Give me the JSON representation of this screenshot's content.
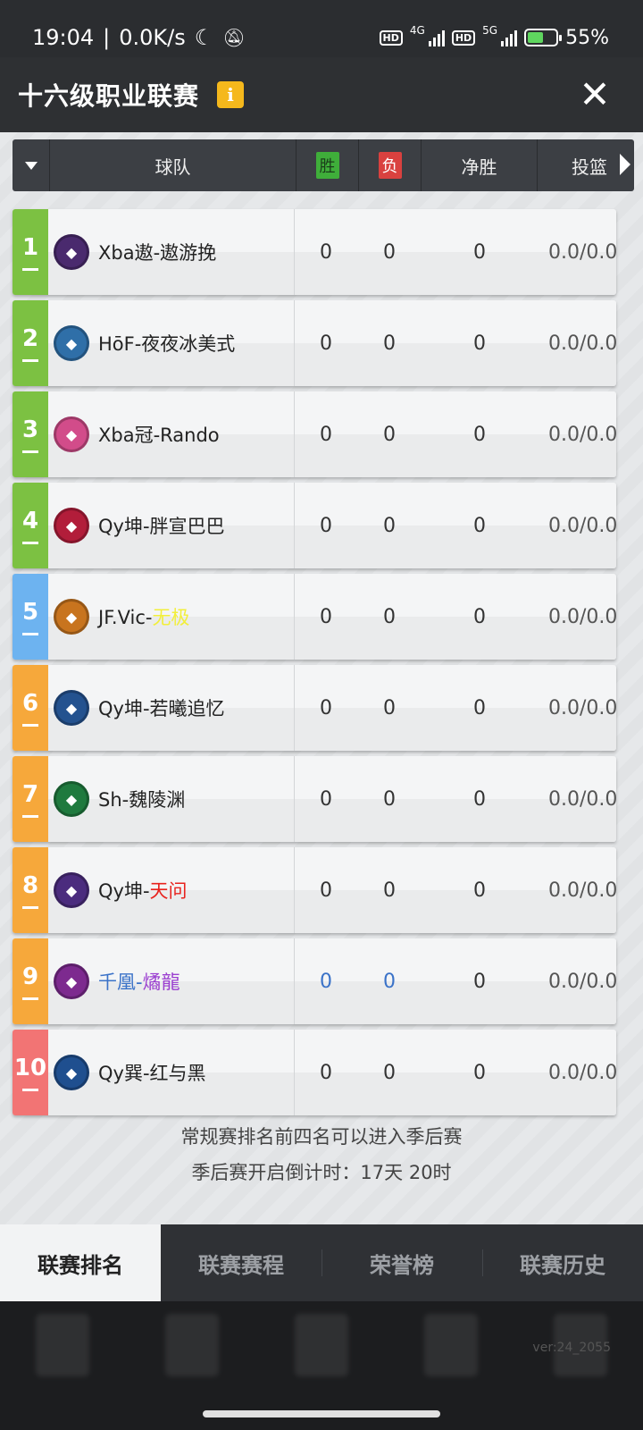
{
  "status_bar": {
    "time": "19:04",
    "speed": "0.0K/s",
    "network_1": "4G",
    "network_2": "5G",
    "hd": "HD",
    "battery": "55%",
    "battery_level": 0.55
  },
  "header": {
    "title": "十六级职业联赛",
    "info_icon": "i",
    "close_icon": "✕"
  },
  "table": {
    "columns": {
      "team": "球队",
      "win": "胜",
      "loss": "负",
      "net": "净胜",
      "shot": "投篮"
    },
    "rows": [
      {
        "rank": "1",
        "name_prefix": "Xba遨-遨游挽",
        "name_suffix": "",
        "win": "0",
        "loss": "0",
        "net": "0",
        "shot": "0.0/0.0",
        "rank_color": "#7cc142",
        "logo_color": "#4a2a6e",
        "suffix_color": "#222"
      },
      {
        "rank": "2",
        "name_prefix": "HōF-夜夜冰美式",
        "name_suffix": "",
        "win": "0",
        "loss": "0",
        "net": "0",
        "shot": "0.0/0.0",
        "rank_color": "#7cc142",
        "logo_color": "#2f6fa8",
        "suffix_color": "#222"
      },
      {
        "rank": "3",
        "name_prefix": "Xba冠-Rando",
        "name_suffix": "",
        "win": "0",
        "loss": "0",
        "net": "0",
        "shot": "0.0/0.0",
        "rank_color": "#7cc142",
        "logo_color": "#d24c8a",
        "suffix_color": "#222"
      },
      {
        "rank": "4",
        "name_prefix": "Qy坤-胖宣巴巴",
        "name_suffix": "",
        "win": "0",
        "loss": "0",
        "net": "0",
        "shot": "0.0/0.0",
        "rank_color": "#7cc142",
        "logo_color": "#b21d3a",
        "suffix_color": "#222"
      },
      {
        "rank": "5",
        "name_prefix": "JF.Vic-",
        "name_suffix": "无极",
        "win": "0",
        "loss": "0",
        "net": "0",
        "shot": "0.0/0.0",
        "rank_color": "#6db3f0",
        "logo_color": "#c8741e",
        "suffix_color": "#f2ef3a"
      },
      {
        "rank": "6",
        "name_prefix": "Qy坤-若曦追忆",
        "name_suffix": "",
        "win": "0",
        "loss": "0",
        "net": "0",
        "shot": "0.0/0.0",
        "rank_color": "#f6a83b",
        "logo_color": "#24528f",
        "suffix_color": "#222"
      },
      {
        "rank": "7",
        "name_prefix": "Sh",
        "name_suffix": "-魏陵渊",
        "win": "0",
        "loss": "0",
        "net": "0",
        "shot": "0.0/0.0",
        "rank_color": "#f6a83b",
        "logo_color": "#1f7a3e",
        "suffix_color": "#222"
      },
      {
        "rank": "8",
        "name_prefix": "Qy坤-",
        "name_suffix": "天问",
        "win": "0",
        "loss": "0",
        "net": "0",
        "shot": "0.0/0.0",
        "rank_color": "#f6a83b",
        "logo_color": "#4b2c7e",
        "suffix_color": "#e8231e"
      },
      {
        "rank": "9",
        "name_prefix": "千凰-",
        "name_suffix": "燏龍",
        "win": "0",
        "loss": "0",
        "net": "0",
        "shot": "0.0/0.0",
        "rank_color": "#f6a83b",
        "logo_color": "#7d2a8f",
        "suffix_color": "#9b3fd0"
      },
      {
        "rank": "10",
        "name_prefix": "Qy巽-红与黑",
        "name_suffix": "",
        "win": "0",
        "loss": "0",
        "net": "0",
        "shot": "0.0/0.0",
        "rank_color": "#f27474",
        "logo_color": "#1f4f8f",
        "suffix_color": "#222"
      }
    ]
  },
  "notes": {
    "line1": "常规赛排名前四名可以进入季后赛",
    "line2": "季后赛开启倒计时：17天 20时"
  },
  "tabs": [
    {
      "label": "联赛排名",
      "active": true
    },
    {
      "label": "联赛赛程",
      "active": false
    },
    {
      "label": "荣誉榜",
      "active": false
    },
    {
      "label": "联赛历史",
      "active": false
    }
  ],
  "version": "ver:24_2055"
}
